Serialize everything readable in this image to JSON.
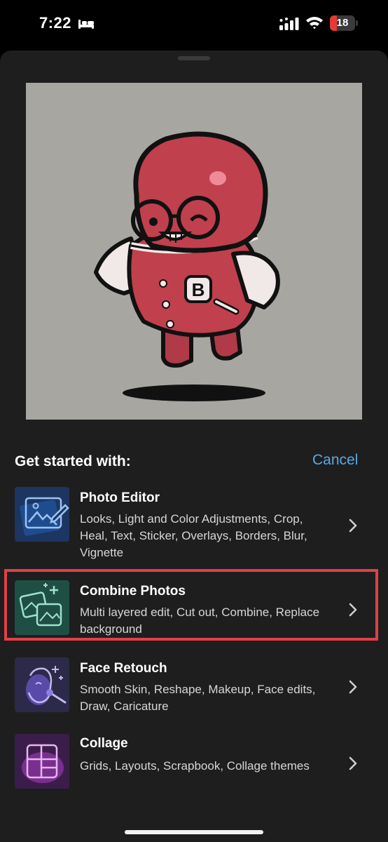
{
  "status_bar": {
    "time": "7:22",
    "battery_level": "18",
    "battery_color": "#e53935",
    "icons": [
      "bed-icon",
      "cellular-signal-icon",
      "wifi-icon",
      "battery-icon"
    ]
  },
  "preview": {
    "description_icon": "sticker-character-image",
    "badge_letter": "B",
    "background_color": "#a7a6a1"
  },
  "sheet": {
    "heading": "Get started with:",
    "cancel_label": "Cancel",
    "accent_color": "#5aa9e6"
  },
  "options": [
    {
      "title": "Photo Editor",
      "description": "Looks, Light and Color Adjustments, Crop, Heal, Text, Sticker, Overlays, Borders, Blur, Vignette",
      "icon": "photo-edit-icon",
      "highlighted": false
    },
    {
      "title": "Combine Photos",
      "description": "Multi layered edit, Cut out, Combine, Replace background",
      "icon": "combine-photos-icon",
      "highlighted": true
    },
    {
      "title": "Face Retouch",
      "description": "Smooth Skin, Reshape, Makeup, Face edits, Draw, Caricature",
      "icon": "face-retouch-icon",
      "highlighted": false
    },
    {
      "title": "Collage",
      "description": "Grids, Layouts, Scrapbook, Collage themes",
      "icon": "collage-icon",
      "highlighted": false
    }
  ],
  "highlight_color": "#e0404a"
}
